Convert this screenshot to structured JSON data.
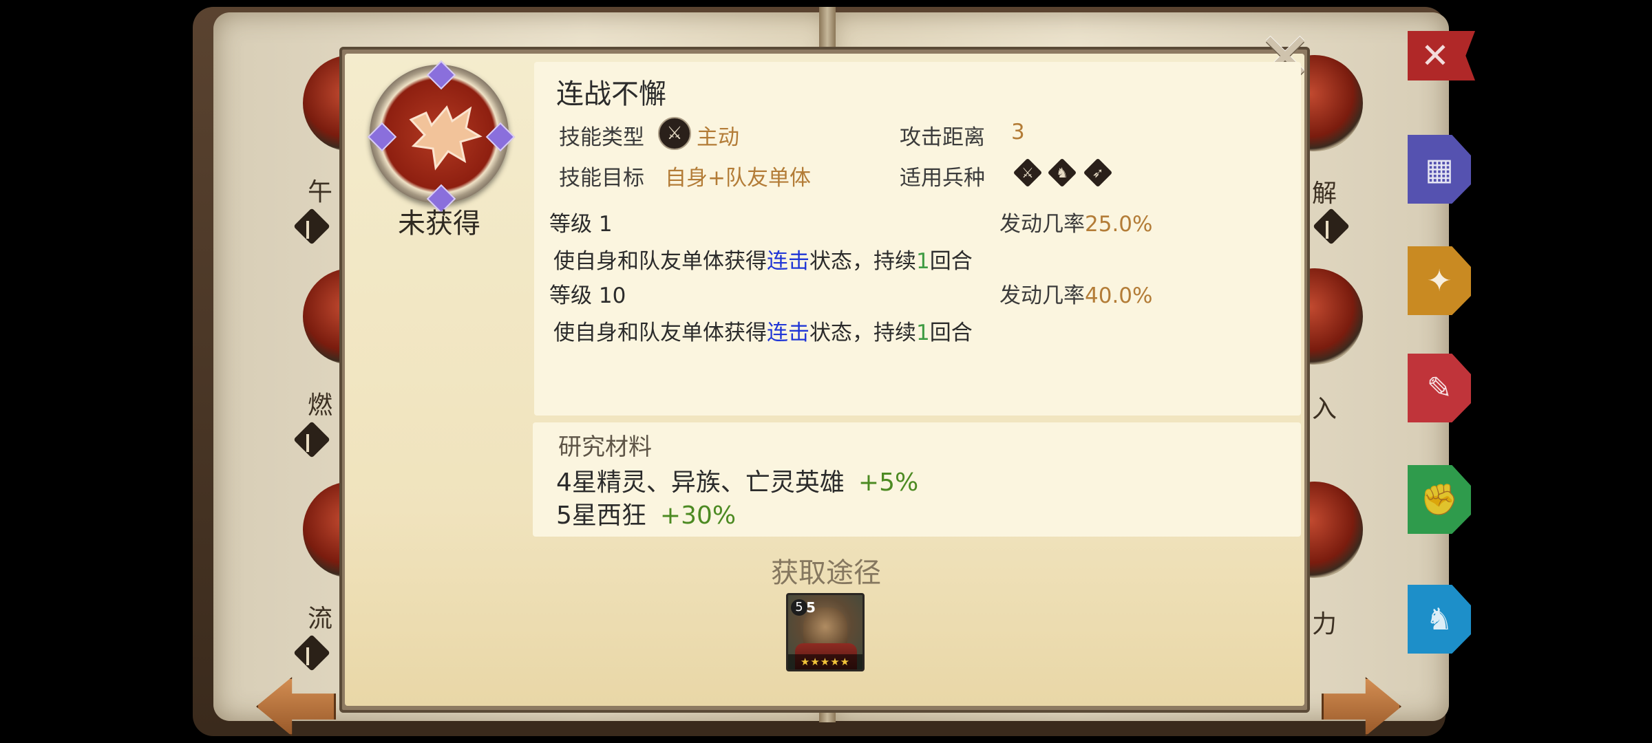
{
  "colors": {
    "accent_value": "#b37c37",
    "link_blue": "#2036d6",
    "duration_green": "#3e9b42",
    "bonus_green": "#4c8a22",
    "close_tab_red": "#b02828"
  },
  "background": {
    "list_items": [
      {
        "label": "午",
        "badge_icon": "sword-icon"
      },
      {
        "label": "燃",
        "badge_icon": "sword-icon"
      },
      {
        "label": "流",
        "badge_icon": "sword-icon"
      }
    ],
    "right_list_items": [
      {
        "label": "解",
        "badge_icon": "bow-icon"
      },
      {
        "label": "入"
      },
      {
        "label": "力"
      }
    ],
    "side_tabs": [
      {
        "icon": "grid-icon",
        "color": "#5552b0"
      },
      {
        "icon": "compass-icon",
        "color": "#c98a22"
      },
      {
        "icon": "skill-icon",
        "color": "#c0343a"
      },
      {
        "icon": "fist-icon",
        "color": "#2f9b4c"
      },
      {
        "icon": "horse-icon",
        "color": "#1d8fc9"
      }
    ]
  },
  "skill": {
    "status": "未获得",
    "name": "连战不懈",
    "type_label": "技能类型",
    "type_value": "主动",
    "range_label": "攻击距离",
    "range_value": "3",
    "target_label": "技能目标",
    "target_value": "自身+队友单体",
    "unit_label": "适用兵种",
    "unit_icons": [
      "sword-icon",
      "horse-icon",
      "bow-icon"
    ],
    "levels": [
      {
        "level_text": "等级 1",
        "rate_label": "发动几率",
        "rate_value": "25.0%",
        "desc_pre": "使自身和队友单体获得",
        "desc_link": "连击",
        "desc_mid": "状态，持续",
        "desc_num": "1",
        "desc_post": "回合"
      },
      {
        "level_text": "等级 10",
        "rate_label": "发动几率",
        "rate_value": "40.0%",
        "desc_pre": "使自身和队友单体获得",
        "desc_link": "连击",
        "desc_mid": "状态，持续",
        "desc_num": "1",
        "desc_post": "回合"
      }
    ]
  },
  "research": {
    "title": "研究材料",
    "items": [
      {
        "text": "4星精灵、异族、亡灵英雄",
        "bonus": "+5%"
      },
      {
        "text": "5星西狂",
        "bonus": "+30%"
      }
    ]
  },
  "source": {
    "title": "获取途径",
    "hero": {
      "level_badge": "5",
      "count": "5",
      "stars": "★★★★★"
    }
  }
}
